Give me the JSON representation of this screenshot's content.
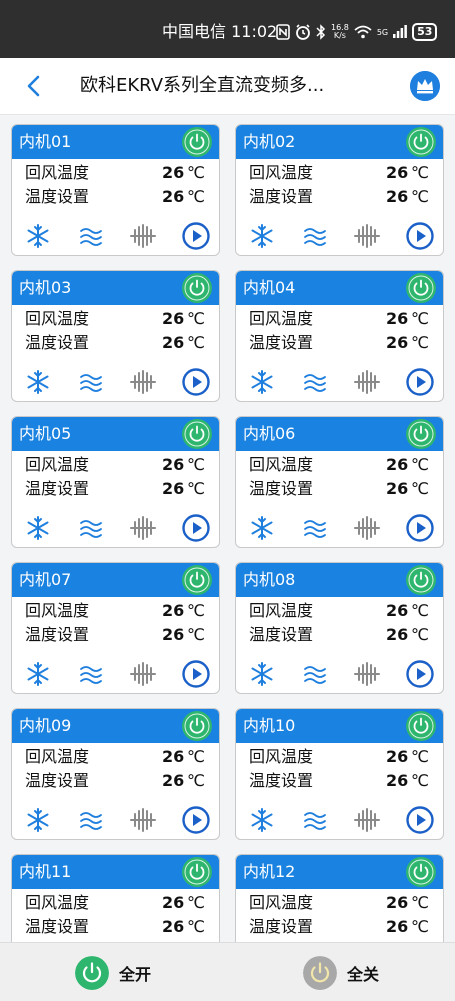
{
  "status_bar": {
    "carrier_time": "中国电信 11:02",
    "net_speed_top": "16.8",
    "net_speed_bottom": "K/s",
    "signal_label": "5G",
    "battery": "53"
  },
  "nav": {
    "title": "欧科EKRV系列全直流变频多..."
  },
  "labels": {
    "return_air": "回风温度",
    "set_temp": "温度设置",
    "unit": "℃"
  },
  "units": [
    {
      "name": "内机01",
      "return_air": "26",
      "set_temp": "26"
    },
    {
      "name": "内机02",
      "return_air": "26",
      "set_temp": "26"
    },
    {
      "name": "内机03",
      "return_air": "26",
      "set_temp": "26"
    },
    {
      "name": "内机04",
      "return_air": "26",
      "set_temp": "26"
    },
    {
      "name": "内机05",
      "return_air": "26",
      "set_temp": "26"
    },
    {
      "name": "内机06",
      "return_air": "26",
      "set_temp": "26"
    },
    {
      "name": "内机07",
      "return_air": "26",
      "set_temp": "26"
    },
    {
      "name": "内机08",
      "return_air": "26",
      "set_temp": "26"
    },
    {
      "name": "内机09",
      "return_air": "26",
      "set_temp": "26"
    },
    {
      "name": "内机10",
      "return_air": "26",
      "set_temp": "26"
    },
    {
      "name": "内机11",
      "return_air": "26",
      "set_temp": "26"
    },
    {
      "name": "内机12",
      "return_air": "26",
      "set_temp": "26"
    }
  ],
  "bottom": {
    "all_on": "全开",
    "all_off": "全关"
  },
  "colors": {
    "header_blue": "#1a82e0",
    "power_green": "#2fb66e",
    "power_gray": "#a8a8a8",
    "icon_blue": "#1f7fde",
    "icon_gray": "#8a8a8a"
  }
}
